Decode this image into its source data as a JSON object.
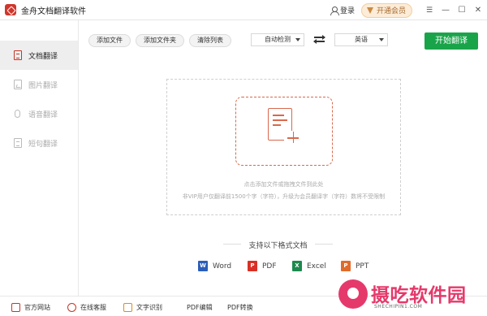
{
  "app": {
    "title": "金舟文档翻译软件"
  },
  "titlebar": {
    "login_label": "登录",
    "vip_label": "开通会员",
    "menu_glyph": "☰",
    "minimize_glyph": "—",
    "maximize_glyph": "☐",
    "close_glyph": "✕"
  },
  "sidebar": {
    "items": [
      {
        "label": "文档翻译",
        "icon": "document-icon",
        "active": true
      },
      {
        "label": "图片翻译",
        "icon": "image-icon",
        "active": false
      },
      {
        "label": "语音翻译",
        "icon": "microphone-icon",
        "active": false
      },
      {
        "label": "短句翻译",
        "icon": "sentence-icon",
        "active": false
      }
    ]
  },
  "toolbar": {
    "add_file": "添加文件",
    "add_folder": "添加文件夹",
    "clear_list": "清除列表",
    "source_lang": "自动检测",
    "target_lang": "英语",
    "start": "开始翻译"
  },
  "dropzone": {
    "hint": "点击添加文件或拖拽文件到此处",
    "limit_notice": "非VIP用户仅翻译前1500个字（字符），升级为会员翻译字（字符）数将不受限制"
  },
  "formats": {
    "title": "支持以下格式文档",
    "items": [
      {
        "label": "Word",
        "icon": "word-icon",
        "color": "#2b5eb8",
        "letter": "W"
      },
      {
        "label": "PDF",
        "icon": "pdf-icon",
        "color": "#d93025",
        "letter": "P"
      },
      {
        "label": "Excel",
        "icon": "excel-icon",
        "color": "#1d8a4e",
        "letter": "X"
      },
      {
        "label": "PPT",
        "icon": "ppt-icon",
        "color": "#e06b2b",
        "letter": "P"
      }
    ]
  },
  "bottombar": {
    "items": [
      {
        "label": "官方网站"
      },
      {
        "label": "在线客服"
      },
      {
        "label": "文字识别"
      },
      {
        "label": "PDF编辑"
      },
      {
        "label": "PDF转换"
      }
    ]
  },
  "watermark": {
    "text": "摄吃软件园",
    "sub": "SHECHIPIN1.COM"
  },
  "colors": {
    "accent": "#c43527",
    "start_button": "#1aa44a",
    "dropzone_accent": "#d9684c"
  }
}
